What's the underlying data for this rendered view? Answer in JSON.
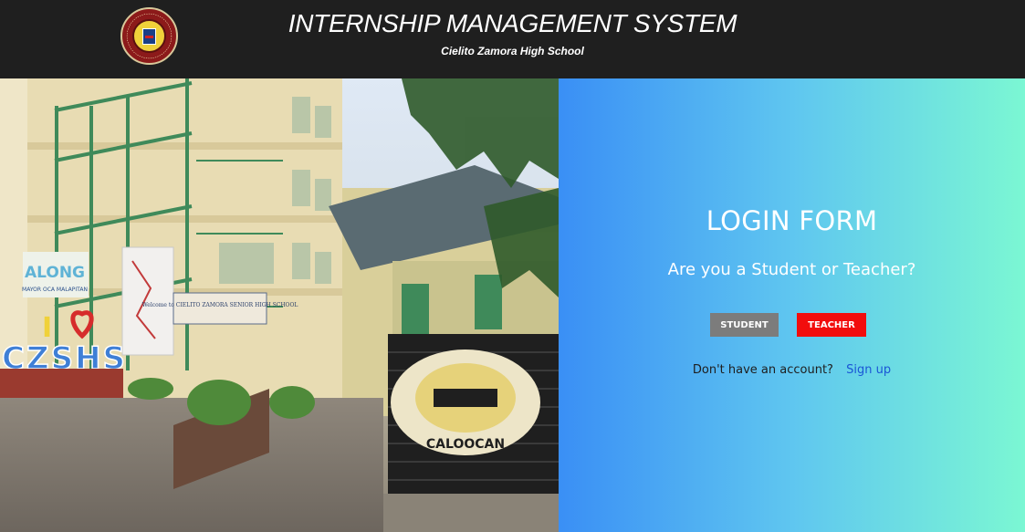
{
  "header": {
    "title": "INTERNSHIP MANAGEMENT SYSTEM",
    "subtitle": "Cielito Zamora High School",
    "logo_text": "CIELITO ZAMORA HIGH SCHOOL · CALOOCAN"
  },
  "photo": {
    "signs": {
      "along": "ALONG",
      "mayor": "MAYOR OCA MALAPITAN",
      "heart_i": "I",
      "czshs": "CZSHS",
      "welcome": "Welcome to CIELITO ZAMORA SENIOR HIGH SCHOOL",
      "stairs_text": "CALOOCAN"
    }
  },
  "login": {
    "title": "LOGIN FORM",
    "question": "Are you a Student or Teacher?",
    "student_label": "STUDENT",
    "teacher_label": "TEACHER",
    "no_account_text": "Don't have an account?",
    "signup_label": "Sign up"
  },
  "colors": {
    "header_bg": "#1f1f1f",
    "gradient_start": "#3a8ff5",
    "gradient_end": "#7bf7d3",
    "student_btn": "#7c7c7c",
    "teacher_btn": "#f20d0d",
    "link": "#1a56d6"
  }
}
